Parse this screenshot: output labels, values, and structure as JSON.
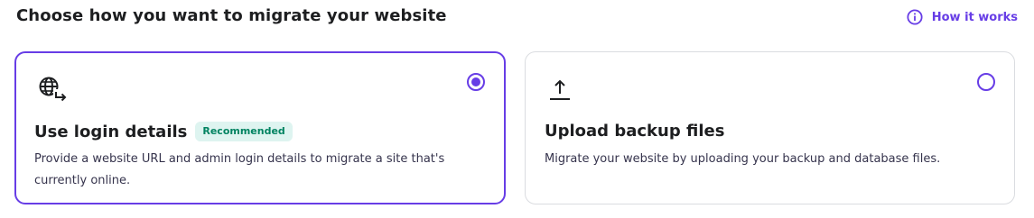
{
  "header": {
    "title": "Choose how you want to migrate your website",
    "help_link": "How it works",
    "help_icon": "info-circle-icon"
  },
  "options": [
    {
      "icon": "globe-arrow-icon",
      "title": "Use login details",
      "badge": "Recommended",
      "description": "Provide a website URL and admin login details to migrate a site that's currently online.",
      "selected": true
    },
    {
      "icon": "upload-icon",
      "title": "Upload backup files",
      "badge": "",
      "description": "Migrate your website by uploading your backup and database files.",
      "selected": false
    }
  ],
  "colors": {
    "accent": "#673de6",
    "badge_bg": "#def4f0",
    "badge_text": "#008361",
    "border": "#dadce0",
    "text": "#1d1e20"
  }
}
